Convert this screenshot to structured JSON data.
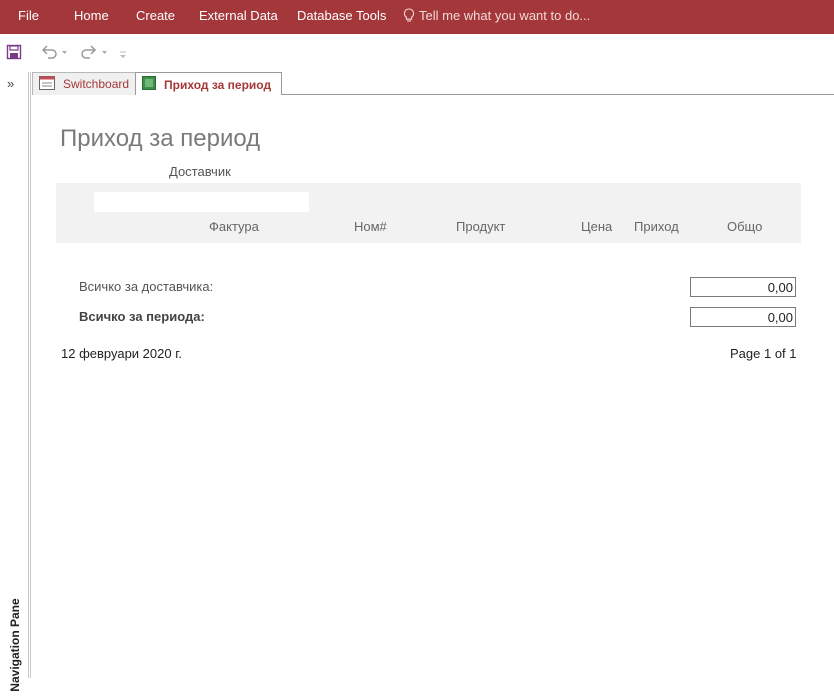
{
  "ribbon": {
    "tabs": [
      "File",
      "Home",
      "Create",
      "External Data",
      "Database Tools"
    ],
    "tell_me": "Tell me what you want to do...",
    "color": "#a4373a"
  },
  "quick_access": {
    "icons": [
      "save-icon",
      "undo-icon",
      "redo-icon",
      "customize-icon"
    ]
  },
  "nav_pane": {
    "label": "Navigation Pane",
    "toggle": "»"
  },
  "doc_tabs": [
    {
      "label": "Switchboard",
      "icon": "form-icon"
    },
    {
      "label": "Приход за период",
      "icon": "report-icon",
      "active": true
    }
  ],
  "report": {
    "title": "Приход за период",
    "supplier_label": "Доставчик",
    "columns": [
      "Фактура",
      "Ном#",
      "Продукт",
      "Цена",
      "Приход",
      "Общо"
    ],
    "supplier_total_label": "Всичко за доставчика:",
    "supplier_total_value": "0,00",
    "period_total_label": "Всичко за периода:",
    "period_total_value": "0,00",
    "date": "12 февруари 2020 г.",
    "page_info": "Page 1 of 1"
  }
}
